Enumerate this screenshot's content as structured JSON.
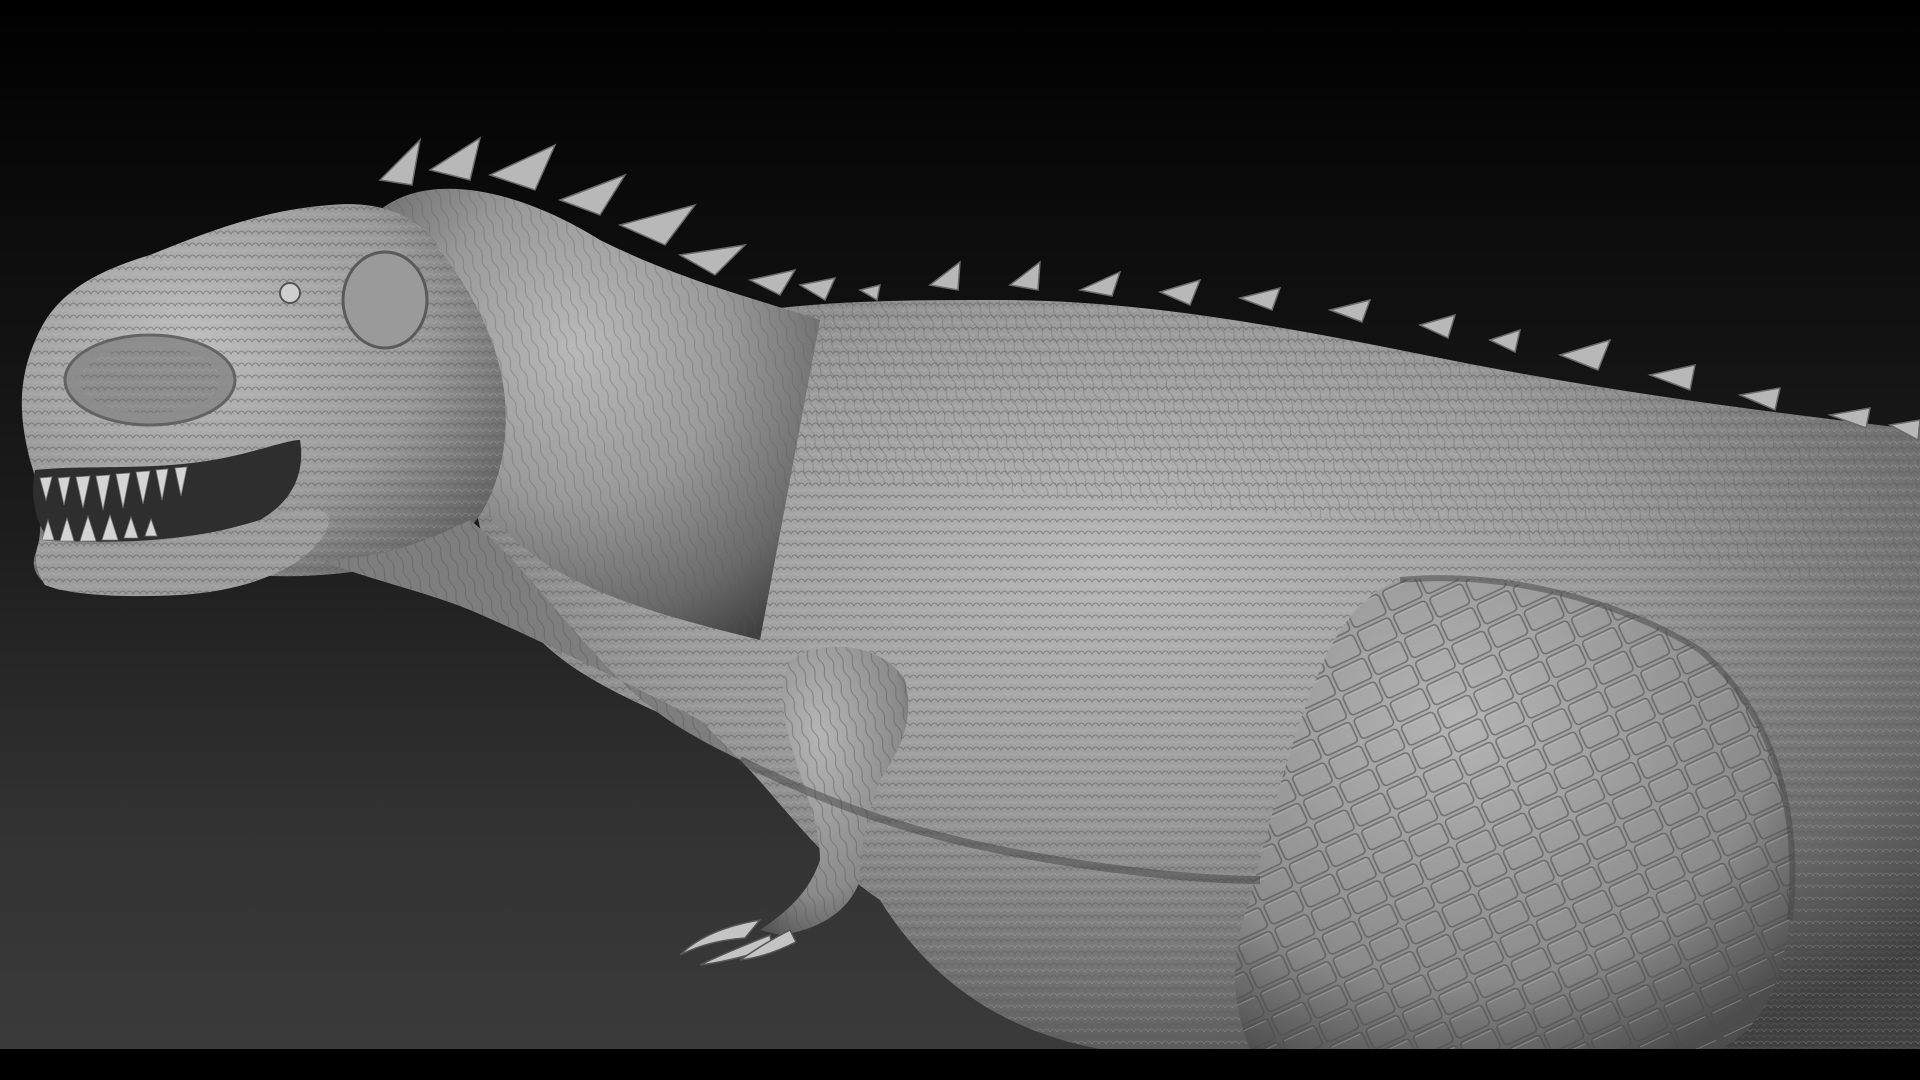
{
  "scene": {
    "subject": "sculpted-dinosaur-model",
    "colors": {
      "background_top": "#000000",
      "background_bottom": "#3a3a3a",
      "model_light": "#c8c8c8",
      "model_mid": "#8e8e8e",
      "model_dark": "#3c3c3c",
      "bottom_bar": "#000000"
    }
  }
}
